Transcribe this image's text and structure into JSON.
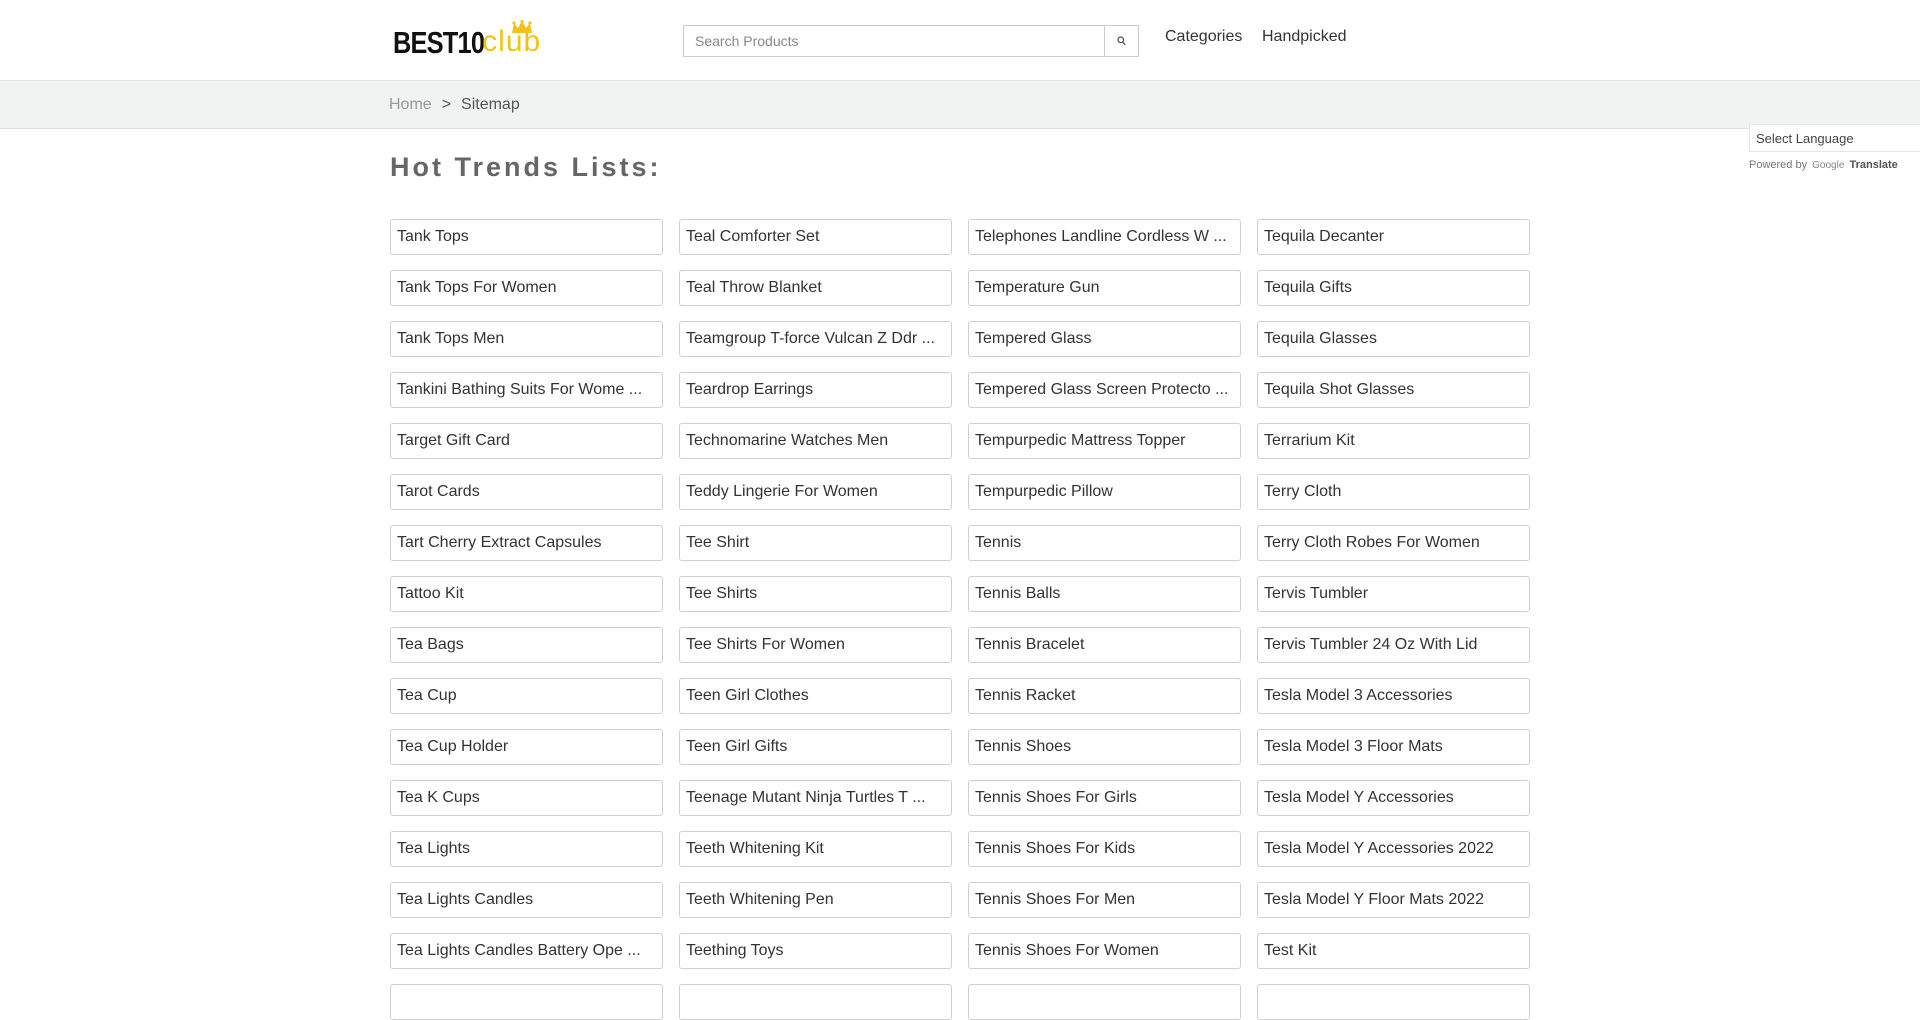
{
  "header": {
    "logo": {
      "main": "BEST10",
      "accent": "club"
    },
    "search": {
      "placeholder": "Search Products"
    },
    "nav": [
      "Categories",
      "Handpicked"
    ]
  },
  "breadcrumb": {
    "home": "Home",
    "separator": ">",
    "current": "Sitemap"
  },
  "translate": {
    "select_label": "Select Language",
    "powered_by": "Powered by",
    "google": "Google",
    "translate": "Translate"
  },
  "main": {
    "heading": "Hot Trends Lists:",
    "rows": [
      [
        "Tank Tops",
        "Teal Comforter Set",
        "Telephones Landline Cordless W ...",
        "Tequila Decanter"
      ],
      [
        "Tank Tops For Women",
        "Teal Throw Blanket",
        "Temperature Gun",
        "Tequila Gifts"
      ],
      [
        "Tank Tops Men",
        "Teamgroup T-force Vulcan Z Ddr ...",
        "Tempered Glass",
        "Tequila Glasses"
      ],
      [
        "Tankini Bathing Suits For Wome ...",
        "Teardrop Earrings",
        "Tempered Glass Screen Protecto ...",
        "Tequila Shot Glasses"
      ],
      [
        "Target Gift Card",
        "Technomarine Watches Men",
        "Tempurpedic Mattress Topper",
        "Terrarium Kit"
      ],
      [
        "Tarot Cards",
        "Teddy Lingerie For Women",
        "Tempurpedic Pillow",
        "Terry Cloth"
      ],
      [
        "Tart Cherry Extract Capsules",
        "Tee Shirt",
        "Tennis",
        "Terry Cloth Robes For Women"
      ],
      [
        "Tattoo Kit",
        "Tee Shirts",
        "Tennis Balls",
        "Tervis Tumbler"
      ],
      [
        "Tea Bags",
        "Tee Shirts For Women",
        "Tennis Bracelet",
        "Tervis Tumbler 24 Oz With Lid"
      ],
      [
        "Tea Cup",
        "Teen Girl Clothes",
        "Tennis Racket",
        "Tesla Model 3 Accessories"
      ],
      [
        "Tea Cup Holder",
        "Teen Girl Gifts",
        "Tennis Shoes",
        "Tesla Model 3 Floor Mats"
      ],
      [
        "Tea K Cups",
        "Teenage Mutant Ninja Turtles T ...",
        "Tennis Shoes For Girls",
        "Tesla Model Y Accessories"
      ],
      [
        "Tea Lights",
        "Teeth Whitening Kit",
        "Tennis Shoes For Kids",
        "Tesla Model Y Accessories 2022"
      ],
      [
        "Tea Lights Candles",
        "Teeth Whitening Pen",
        "Tennis Shoes For Men",
        "Tesla Model Y Floor Mats 2022"
      ],
      [
        "Tea Lights Candles Battery Ope ...",
        "Teething Toys",
        "Tennis Shoes For Women",
        "Test Kit"
      ],
      [
        "",
        "",
        "",
        ""
      ]
    ]
  },
  "colors": {
    "logo_accent": "#f2c21b",
    "crumb_bar": "#f1f2f2",
    "heading": "#666666",
    "border": "#cfcfcf"
  }
}
